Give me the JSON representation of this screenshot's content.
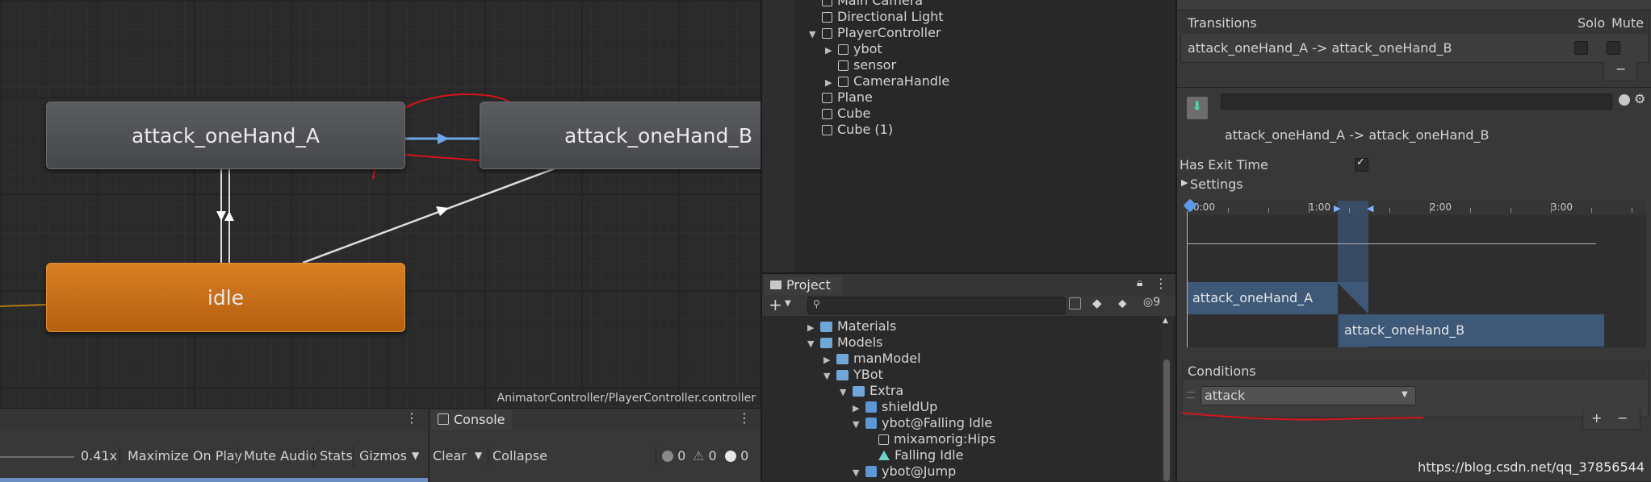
{
  "graph": {
    "nodes": {
      "state_a": "attack_oneHand_A",
      "state_b": "attack_oneHand_B",
      "idle": "idle"
    },
    "controller_path": "AnimatorController/PlayerController.controller",
    "colors": {
      "state_default": "#4f5155",
      "state_entry": "#c96e18",
      "transition": "#dcdcdc",
      "selected_transition": "#6ea7e8",
      "annotation": "#d6141a"
    }
  },
  "game_toolbar": {
    "scale_value": "0.41x",
    "maximize_on_play": "Maximize On Play",
    "mute_audio": "Mute Audio",
    "stats": "Stats",
    "gizmos": "Gizmos"
  },
  "console": {
    "tab_label": "Console",
    "clear": "Clear",
    "collapse": "Collapse",
    "log_count": "0",
    "warn_count": "0",
    "error_count": "0"
  },
  "hierarchy": {
    "items": [
      {
        "label": "Main Camera"
      },
      {
        "label": "Directional Light"
      },
      {
        "label": "PlayerController"
      },
      {
        "label": "ybot"
      },
      {
        "label": "sensor"
      },
      {
        "label": "CameraHandle"
      },
      {
        "label": "Plane"
      },
      {
        "label": "Cube"
      },
      {
        "label": "Cube (1)"
      }
    ]
  },
  "project": {
    "tab_label": "Project",
    "hidden_count": "9",
    "tree": [
      {
        "label": "Materials"
      },
      {
        "label": "Models"
      },
      {
        "label": "manModel"
      },
      {
        "label": "YBot"
      },
      {
        "label": "Extra"
      },
      {
        "label": "shieldUp"
      },
      {
        "label": "ybot@Falling Idle"
      },
      {
        "label": "mixamorig:Hips"
      },
      {
        "label": "Falling Idle"
      },
      {
        "label": "ybot@Jump"
      }
    ]
  },
  "inspector": {
    "transitions_header": "Transitions",
    "solo_label": "Solo",
    "mute_label": "Mute",
    "transition_item": "attack_oneHand_A -> attack_oneHand_B",
    "transition_title": "attack_oneHand_A -> attack_oneHand_B",
    "has_exit_time_label": "Has Exit Time",
    "has_exit_time": true,
    "settings_label": "Settings",
    "timeline": {
      "ruler": [
        "0:00",
        "1:00",
        "2:00",
        "3:00"
      ],
      "clip_a": "attack_oneHand_A",
      "clip_b": "attack_oneHand_B"
    },
    "conditions_header": "Conditions",
    "condition_param": "attack",
    "minus": "−",
    "plus": "+"
  },
  "watermark": "https://blog.csdn.net/qq_37856544"
}
